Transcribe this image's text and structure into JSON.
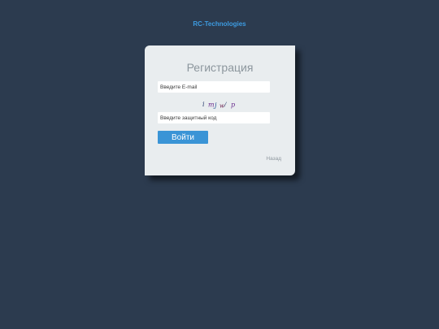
{
  "brand": "RC-Technologies",
  "form": {
    "title": "Регистрация",
    "email_placeholder": "Введите E-mail",
    "captcha_text": "i mj w/ p",
    "code_placeholder": "Введите защитный код",
    "submit_label": "Войти",
    "back_label": "Назад"
  },
  "colors": {
    "background": "#2c3b4f",
    "card": "#e9edef",
    "accent": "#3a94d6",
    "brand": "#3d9be0"
  }
}
